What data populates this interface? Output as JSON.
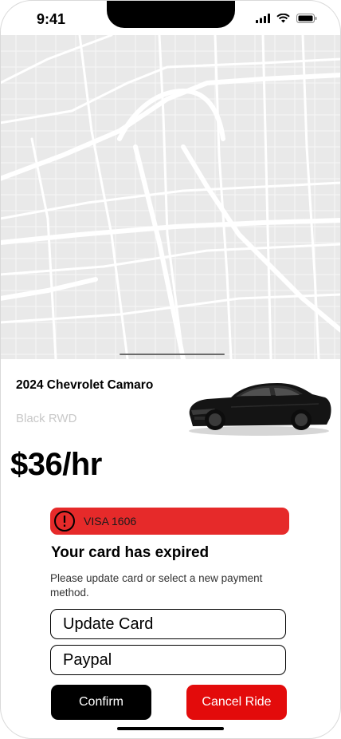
{
  "status_bar": {
    "time": "9:41",
    "icons": [
      "cellular-signal-icon",
      "wifi-icon",
      "battery-icon"
    ]
  },
  "map": {
    "icon": "street-map"
  },
  "vehicle": {
    "title": "2024 Chevrolet Camaro",
    "subtitle": "Black RWD",
    "price": "$36/hr",
    "image": "black-sports-car"
  },
  "payment_alert": {
    "card_label": "VISA 1606",
    "icon": "exclamation-circle-icon",
    "color": "#e62a2a"
  },
  "payment_message": {
    "title": "Your card has expired",
    "description": "Please update card or select a new payment method."
  },
  "payment_options": [
    {
      "label": "Update Card"
    },
    {
      "label": "Paypal"
    }
  ],
  "actions": {
    "confirm_label": "Confirm",
    "cancel_label": "Cancel Ride",
    "confirm_color": "#000000",
    "cancel_color": "#e30b0b"
  }
}
